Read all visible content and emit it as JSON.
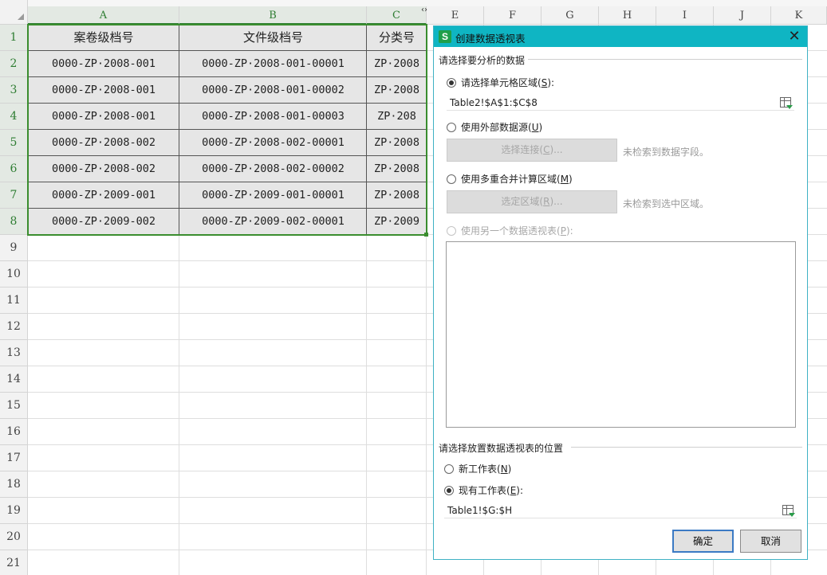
{
  "sheet": {
    "columns": [
      "A",
      "B",
      "C",
      "E",
      "F",
      "G",
      "H",
      "I",
      "J",
      "K"
    ],
    "rows": [
      "1",
      "2",
      "3",
      "4",
      "5",
      "6",
      "7",
      "8",
      "9",
      "10",
      "11",
      "12",
      "13",
      "14",
      "15",
      "16",
      "17",
      "18",
      "19",
      "20",
      "21"
    ],
    "headers": [
      "案卷级档号",
      "文件级档号",
      "分类号"
    ],
    "data": [
      [
        "0000-ZP·2008-001",
        "0000-ZP·2008-001-00001",
        "ZP·2008"
      ],
      [
        "0000-ZP·2008-001",
        "0000-ZP·2008-001-00002",
        "ZP·2008"
      ],
      [
        "0000-ZP·2008-001",
        "0000-ZP·2008-001-00003",
        "ZP·208"
      ],
      [
        "0000-ZP·2008-002",
        "0000-ZP·2008-002-00001",
        "ZP·2008"
      ],
      [
        "0000-ZP·2008-002",
        "0000-ZP·2008-002-00002",
        "ZP·2008"
      ],
      [
        "0000-ZP·2009-001",
        "0000-ZP·2009-001-00001",
        "ZP·2008"
      ],
      [
        "0000-ZP·2009-002",
        "0000-ZP·2009-002-00001",
        "ZP·2009"
      ]
    ]
  },
  "dialog": {
    "app_icon": "S",
    "title": "创建数据透视表",
    "close_icon": "close-icon",
    "section_source": "请选择要分析的数据",
    "opt_range": {
      "label": "请选择单元格区域(",
      "key": "S",
      "suffix": "):",
      "checked": true
    },
    "range_value": "Table2!$A$1:$C$8",
    "opt_external": {
      "label": "使用外部数据源(",
      "key": "U",
      "suffix": ")",
      "checked": false
    },
    "btn_connect": {
      "label": "选择连接(",
      "key": "C",
      "suffix": ")..."
    },
    "hint_connect": "未检索到数据字段。",
    "opt_multi": {
      "label": "使用多重合并计算区域(",
      "key": "M",
      "suffix": ")",
      "checked": false
    },
    "btn_region": {
      "label": "选定区域(",
      "key": "R",
      "suffix": ")..."
    },
    "hint_region": "未检索到选中区域。",
    "opt_pivot": {
      "label": "使用另一个数据透视表(",
      "key": "P",
      "suffix": "):",
      "checked": false
    },
    "section_location": "请选择放置数据透视表的位置",
    "opt_new_sheet": {
      "label": "新工作表(",
      "key": "N",
      "suffix": ")",
      "checked": false
    },
    "opt_existing": {
      "label": "现有工作表(",
      "key": "E",
      "suffix": "):",
      "checked": true
    },
    "location_value": "Table1!$G:$H",
    "btn_ok": "确定",
    "btn_cancel": "取消"
  },
  "colors": {
    "selection": "#3a8d2e",
    "titlebar": "#0fb5c3",
    "primary_border": "#3b7ac4"
  }
}
